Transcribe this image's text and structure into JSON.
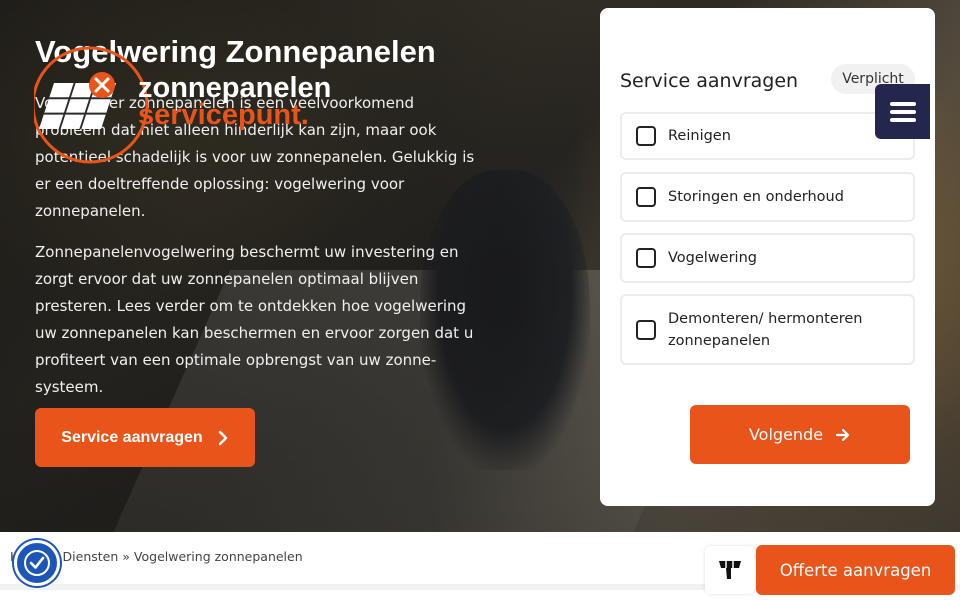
{
  "hero": {
    "title": "Vogelwering Zonnepanelen",
    "paragraphs": [
      "Vogelhinder zonnepanelen is een veelvoorkomend probleem dat niet alleen hinderlijk kan zijn, maar ook potentieel schadelijk is voor uw zonnepanelen. Gelukkig is er een doeltreffende oplossing: vogelwering voor zonnepanelen.",
      "Zonnepanelenvogelwering beschermt uw investering en zorgt ervoor dat uw zonnepanelen optimaal blijven presteren. Lees verder om te ontdekken hoe vogelwering uw zonnepanelen kan beschermen en ervoor zorgen dat u profiteert van een optimale opbrengst van uw zonne-systeem."
    ],
    "cta_label": "Service aanvragen",
    "cta_icon": "chevron-right-icon"
  },
  "logo": {
    "word1": "zonnepanelen",
    "word2": "servicepunt."
  },
  "form": {
    "title": "Service aanvragen",
    "required_badge": "Verplicht",
    "options": [
      {
        "label": "Reinigen",
        "checked": false
      },
      {
        "label": "Storingen en onderhoud",
        "checked": false
      },
      {
        "label": "Vogelwering",
        "checked": false
      },
      {
        "label": "Demonteren/ hermonteren zonnepanelen",
        "checked": false
      }
    ],
    "next_label": "Volgende",
    "next_icon": "arrow-right-icon"
  },
  "menu": {
    "icon": "hamburger-menu-icon"
  },
  "breadcrumb": {
    "home": "Home",
    "separator": "»",
    "diensten": "Diensten",
    "current": "Vogelwering zonnepanelen"
  },
  "bottom": {
    "quote_label": "Offerte aanvragen",
    "accessibility_icon": "accessibility-check-icon",
    "store_icon": "panel-icon"
  },
  "colors": {
    "accent": "#e8541a",
    "navy": "#23264d",
    "access_blue": "#1d56b8"
  }
}
